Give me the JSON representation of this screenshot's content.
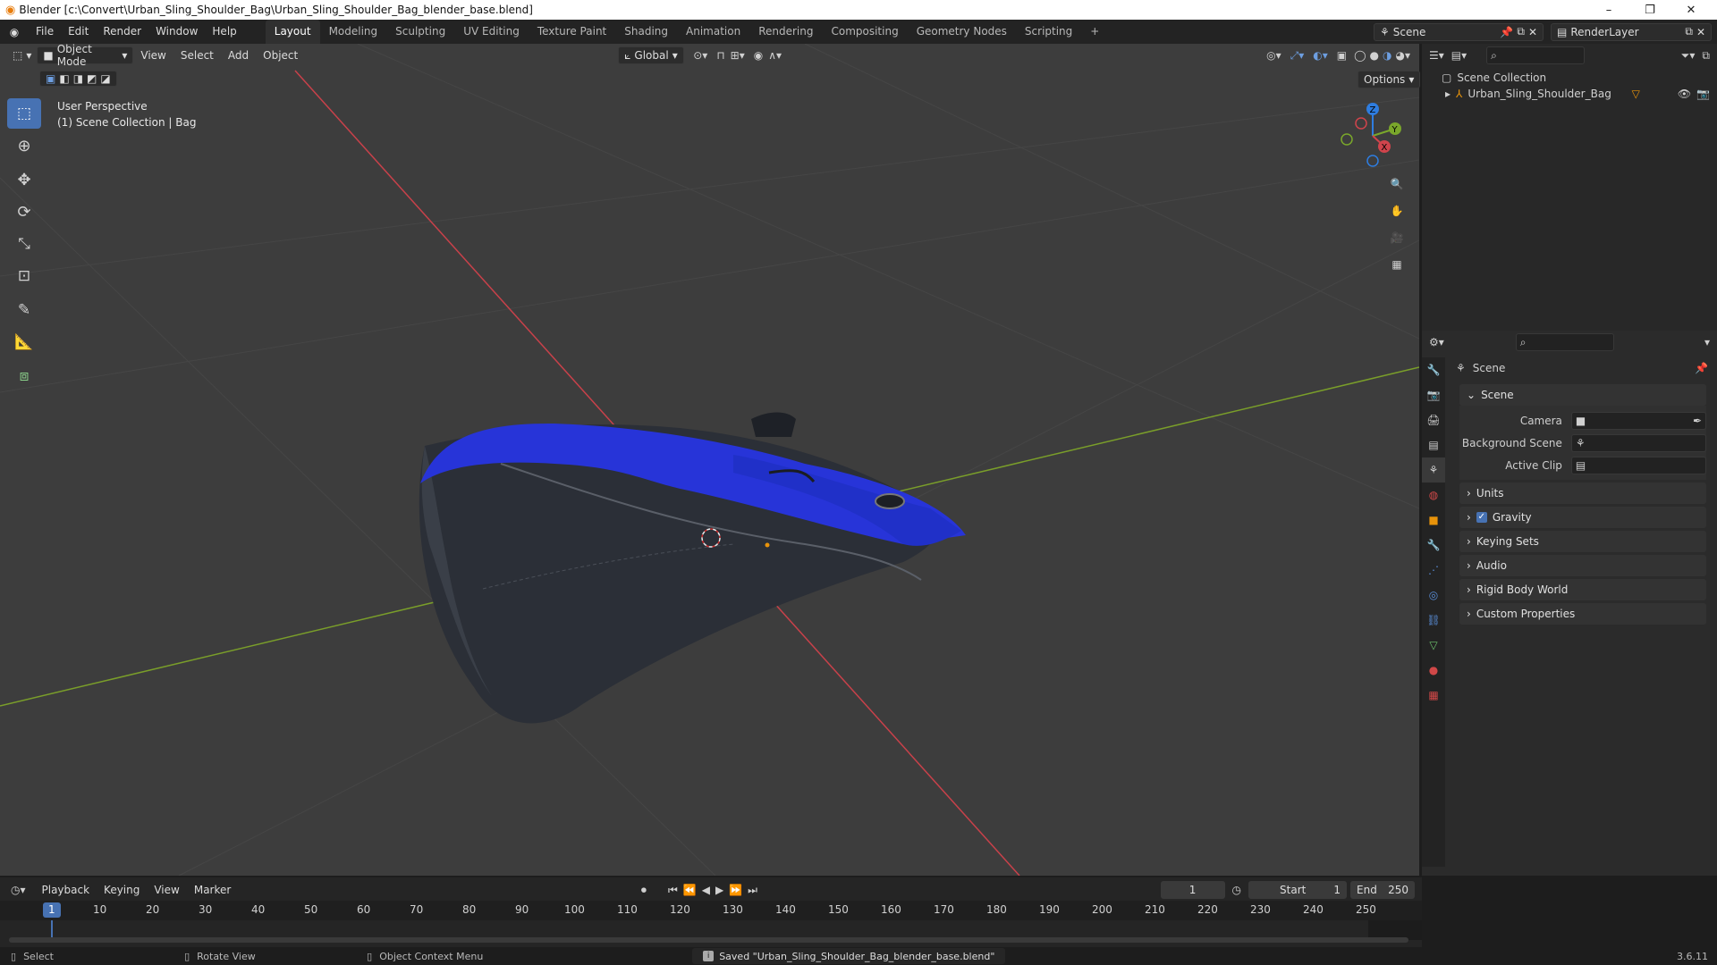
{
  "window": {
    "title": "Blender [c:\\Convert\\Urban_Sling_Shoulder_Bag\\Urban_Sling_Shoulder_Bag_blender_base.blend]",
    "minimize": "–",
    "maximize": "❐",
    "close": "✕"
  },
  "menus": [
    "File",
    "Edit",
    "Render",
    "Window",
    "Help"
  ],
  "workspaces": [
    "Layout",
    "Modeling",
    "Sculpting",
    "UV Editing",
    "Texture Paint",
    "Shading",
    "Animation",
    "Rendering",
    "Compositing",
    "Geometry Nodes",
    "Scripting"
  ],
  "active_workspace": "Layout",
  "add_workspace": "+",
  "scene_selector": "Scene",
  "render_layer": "RenderLayer",
  "viewport_header": {
    "mode": "Object Mode",
    "menus": [
      "View",
      "Select",
      "Add",
      "Object"
    ],
    "orientation": "Global",
    "options": "Options"
  },
  "viewport_overlay": {
    "line1": "User Perspective",
    "line2": "(1) Scene Collection | Bag"
  },
  "gizmo": {
    "x": "X",
    "y": "Y",
    "z": "Z"
  },
  "outliner": {
    "root": "Scene Collection",
    "items": [
      {
        "name": "Urban_Sling_Shoulder_Bag"
      }
    ]
  },
  "properties": {
    "header": "Scene",
    "section": "Scene",
    "fields": [
      {
        "label": "Camera"
      },
      {
        "label": "Background Scene"
      },
      {
        "label": "Active Clip"
      }
    ],
    "panels": [
      "Units",
      "Gravity",
      "Keying Sets",
      "Audio",
      "Rigid Body World",
      "Custom Properties"
    ],
    "gravity_checked": true
  },
  "timeline": {
    "menus": [
      "Playback",
      "Keying",
      "View",
      "Marker"
    ],
    "current_frame": "1",
    "start_label": "Start",
    "start": "1",
    "end_label": "End",
    "end": "250",
    "ruler": [
      "1",
      "10",
      "20",
      "30",
      "40",
      "50",
      "60",
      "70",
      "80",
      "90",
      "100",
      "110",
      "120",
      "130",
      "140",
      "150",
      "160",
      "170",
      "180",
      "190",
      "200",
      "210",
      "220",
      "230",
      "240",
      "250"
    ]
  },
  "statusbar": {
    "select": "Select",
    "rotate": "Rotate View",
    "context": "Object Context Menu",
    "message": "Saved \"Urban_Sling_Shoulder_Bag_blender_base.blend\"",
    "version": "3.6.11"
  },
  "colors": {
    "accent": "#4772b3",
    "x_axis": "#c8414a",
    "y_axis": "#7a9e2a",
    "bag_blue": "#2734d8",
    "bag_dark": "#2b2f37"
  }
}
